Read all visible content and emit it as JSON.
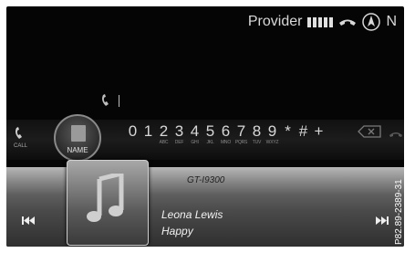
{
  "status": {
    "provider": "Provider",
    "indicator": "N"
  },
  "dial": {
    "call_label": "CALL",
    "name_label": "NAME",
    "keys": [
      {
        "digit": "0",
        "letters": ""
      },
      {
        "digit": "1",
        "letters": ""
      },
      {
        "digit": "2",
        "letters": "ABC"
      },
      {
        "digit": "3",
        "letters": "DEF"
      },
      {
        "digit": "4",
        "letters": "GHI"
      },
      {
        "digit": "5",
        "letters": "JKL"
      },
      {
        "digit": "6",
        "letters": "MNO"
      },
      {
        "digit": "7",
        "letters": "PQRS"
      },
      {
        "digit": "8",
        "letters": "TUV"
      },
      {
        "digit": "9",
        "letters": "WXYZ"
      },
      {
        "digit": "*",
        "letters": ""
      },
      {
        "digit": "#",
        "letters": ""
      },
      {
        "digit": "+",
        "letters": ""
      }
    ]
  },
  "media": {
    "device": "GT-I9300",
    "artist": "Leona Lewis",
    "track": "Happy"
  },
  "figure_code": "P82.89-2389-31"
}
